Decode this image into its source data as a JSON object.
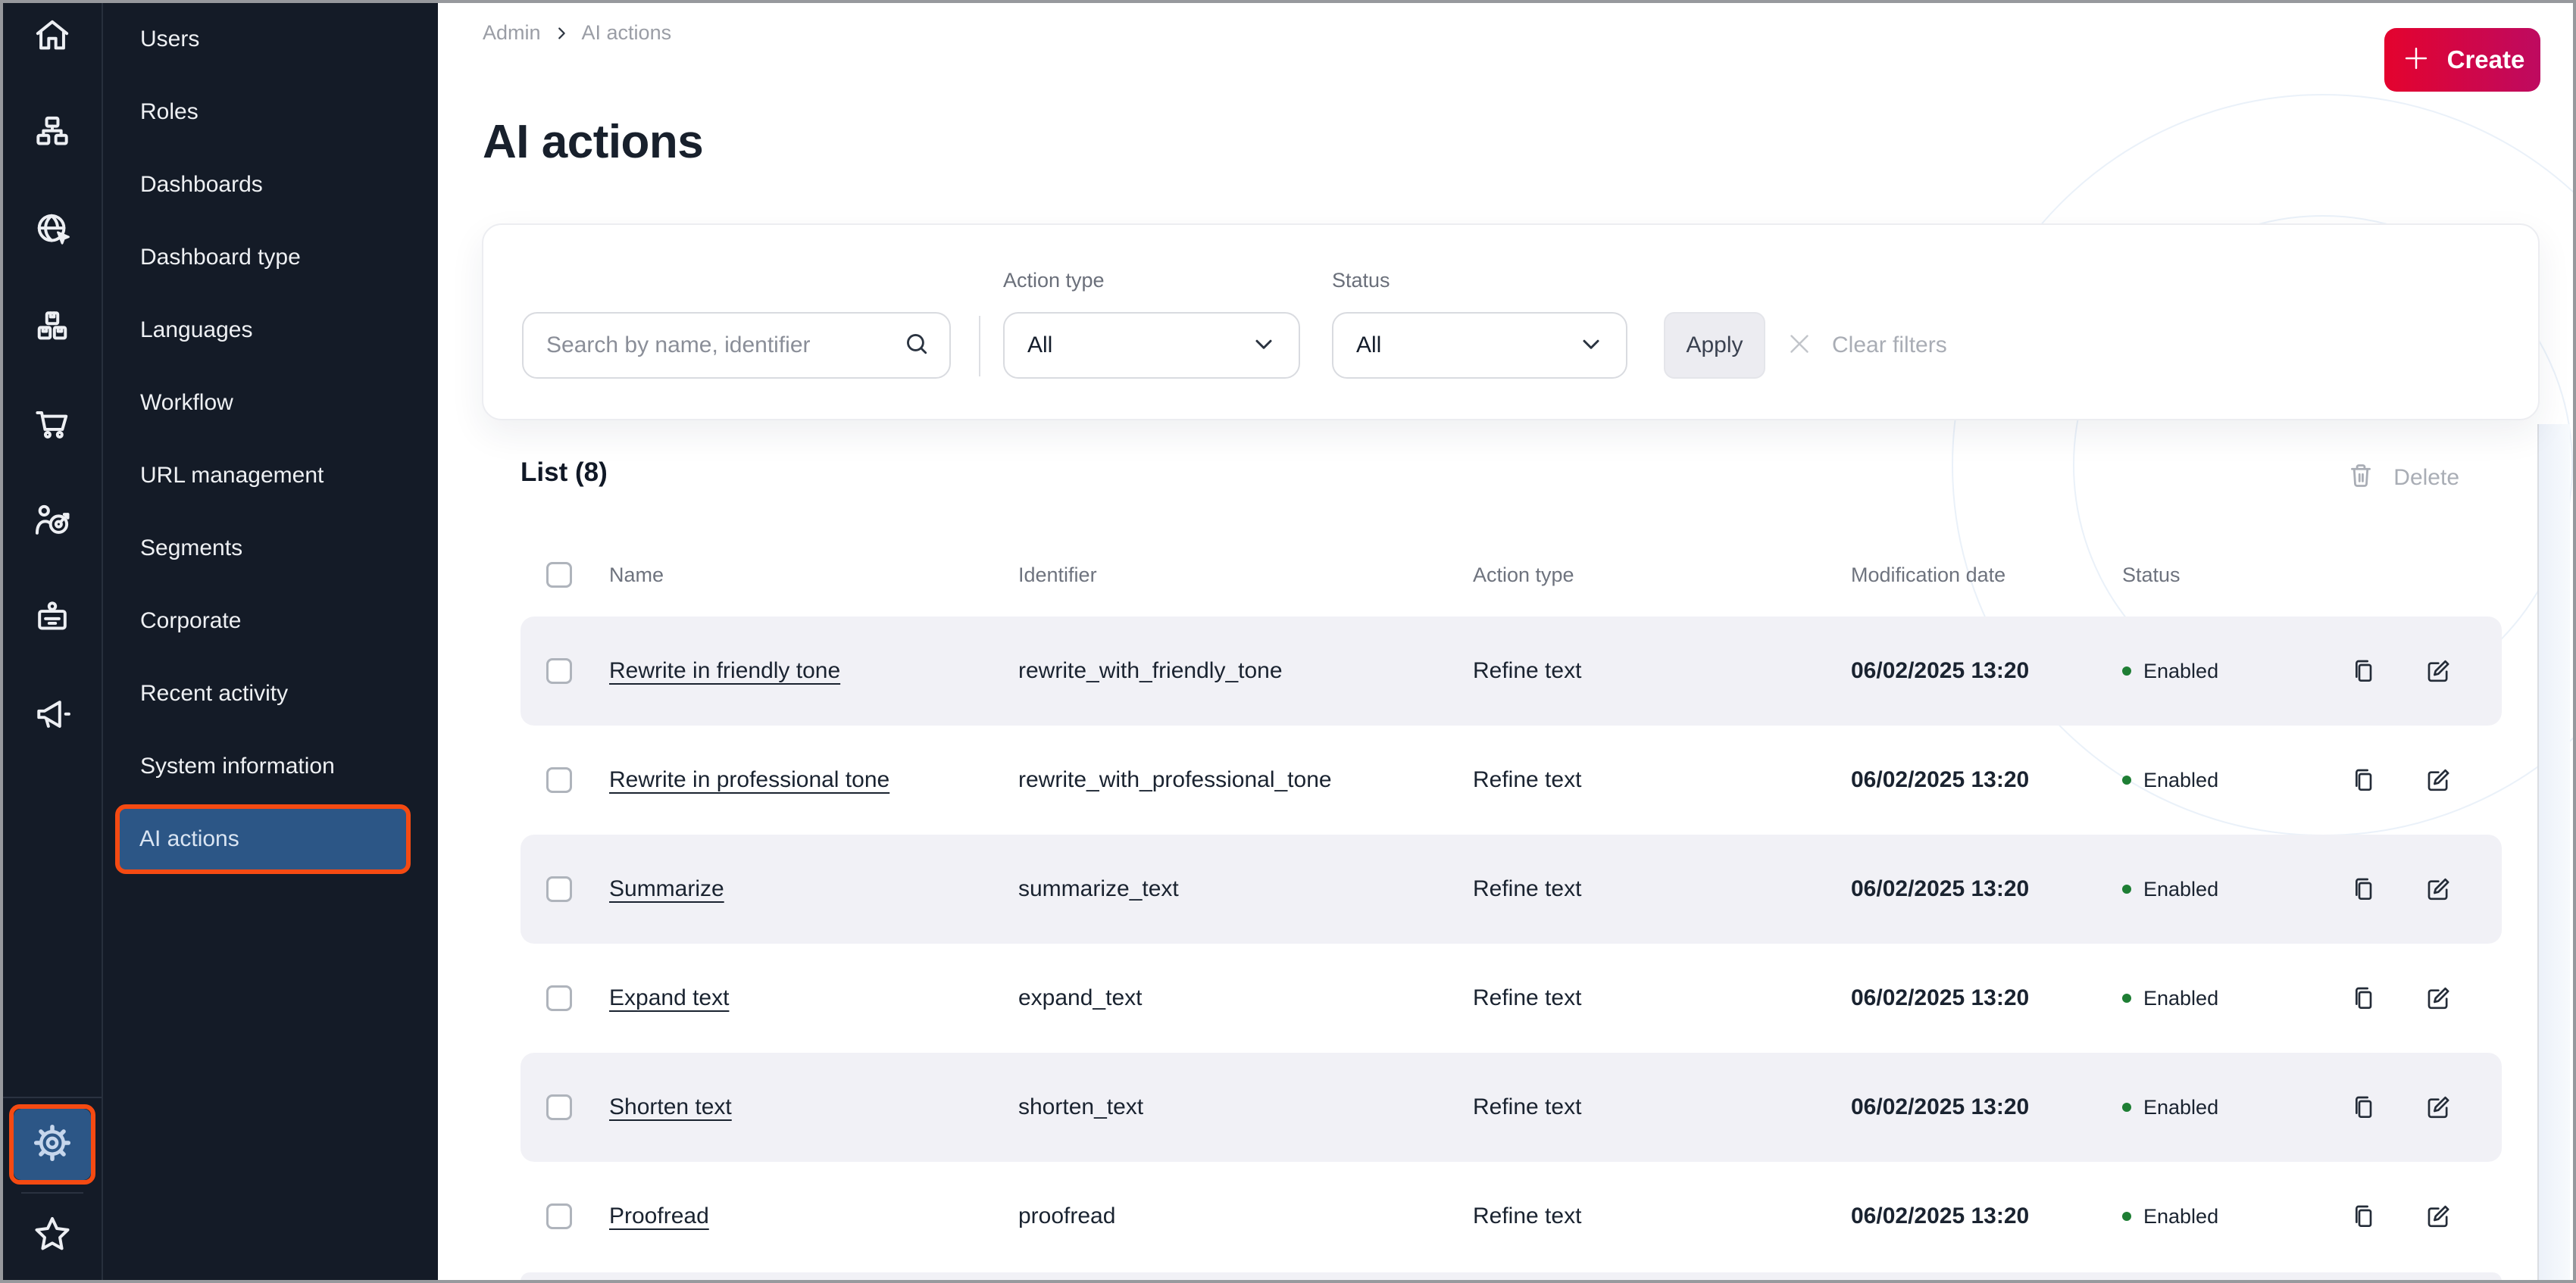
{
  "colors": {
    "sidebar_bg": "#141B27",
    "active_item_bg": "#2C5686",
    "highlight_border": "#F54A12",
    "create_gradient_start": "#E4032E",
    "create_gradient_end": "#BE0A60",
    "status_enabled_green": "#1E7E34",
    "row_alt_bg": "#F1F1F6"
  },
  "icon_rail": {
    "items": [
      {
        "icon": "home-icon"
      },
      {
        "icon": "sitemap-icon"
      },
      {
        "icon": "globe-cursor-icon"
      },
      {
        "icon": "packages-icon"
      },
      {
        "icon": "cart-icon"
      },
      {
        "icon": "audience-target-icon"
      },
      {
        "icon": "badge-icon"
      },
      {
        "icon": "megaphone-icon"
      }
    ],
    "settings_icon": "gear-icon",
    "favorites_icon": "star-icon"
  },
  "sidebar": {
    "active_index": 11,
    "items": [
      {
        "label": "Users"
      },
      {
        "label": "Roles"
      },
      {
        "label": "Dashboards"
      },
      {
        "label": "Dashboard type"
      },
      {
        "label": "Languages"
      },
      {
        "label": "Workflow"
      },
      {
        "label": "URL management"
      },
      {
        "label": "Segments"
      },
      {
        "label": "Corporate"
      },
      {
        "label": "Recent activity"
      },
      {
        "label": "System information"
      },
      {
        "label": "AI actions"
      }
    ]
  },
  "breadcrumb": {
    "parent": "Admin",
    "current": "AI actions"
  },
  "page": {
    "title": "AI actions"
  },
  "toolbar": {
    "create_label": "Create"
  },
  "filters": {
    "search_placeholder": "Search by name, identifier",
    "action_type_label": "Action type",
    "action_type_value": "All",
    "status_label": "Status",
    "status_value": "All",
    "apply_label": "Apply",
    "clear_label": "Clear filters"
  },
  "list": {
    "title": "List (8)",
    "delete_label": "Delete",
    "columns": [
      "Name",
      "Identifier",
      "Action type",
      "Modification date",
      "Status"
    ],
    "rows": [
      {
        "name": "Rewrite in friendly tone",
        "identifier": "rewrite_with_friendly_tone",
        "action_type": "Refine text",
        "modification_date": "06/02/2025 13:20",
        "status": "Enabled"
      },
      {
        "name": "Rewrite in professional tone",
        "identifier": "rewrite_with_professional_tone",
        "action_type": "Refine text",
        "modification_date": "06/02/2025 13:20",
        "status": "Enabled"
      },
      {
        "name": "Summarize",
        "identifier": "summarize_text",
        "action_type": "Refine text",
        "modification_date": "06/02/2025 13:20",
        "status": "Enabled"
      },
      {
        "name": "Expand text",
        "identifier": "expand_text",
        "action_type": "Refine text",
        "modification_date": "06/02/2025 13:20",
        "status": "Enabled"
      },
      {
        "name": "Shorten text",
        "identifier": "shorten_text",
        "action_type": "Refine text",
        "modification_date": "06/02/2025 13:20",
        "status": "Enabled"
      },
      {
        "name": "Proofread",
        "identifier": "proofread",
        "action_type": "Refine text",
        "modification_date": "06/02/2025 13:20",
        "status": "Enabled"
      }
    ]
  }
}
